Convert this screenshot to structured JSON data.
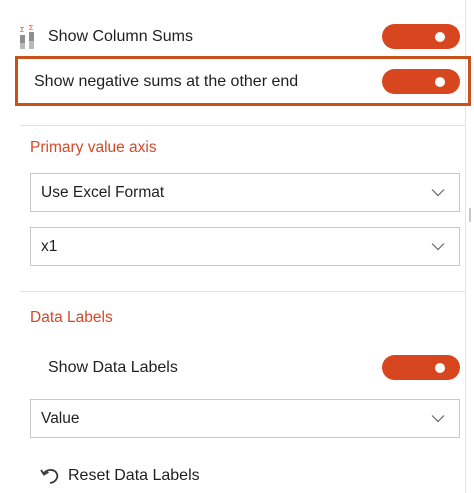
{
  "show_column_sums": {
    "icon": "sigma-columns-icon",
    "label": "Show Column Sums",
    "state": "on"
  },
  "show_negative_sums": {
    "label": "Show negative sums at the other end",
    "state": "on"
  },
  "primary_value_axis": {
    "title": "Primary value axis",
    "format_select": {
      "value": "Use Excel Format"
    },
    "scale_select": {
      "value": "x1"
    }
  },
  "data_labels": {
    "title": "Data Labels",
    "show_label": "Show Data Labels",
    "show_state": "on",
    "value_select": {
      "value": "Value"
    },
    "reset_label": "Reset Data Labels",
    "reset_icon": "undo-arrow-icon"
  },
  "colors": {
    "accent": "#d8461f",
    "section_title": "#d2492a",
    "highlight_border": "#c9521b"
  }
}
